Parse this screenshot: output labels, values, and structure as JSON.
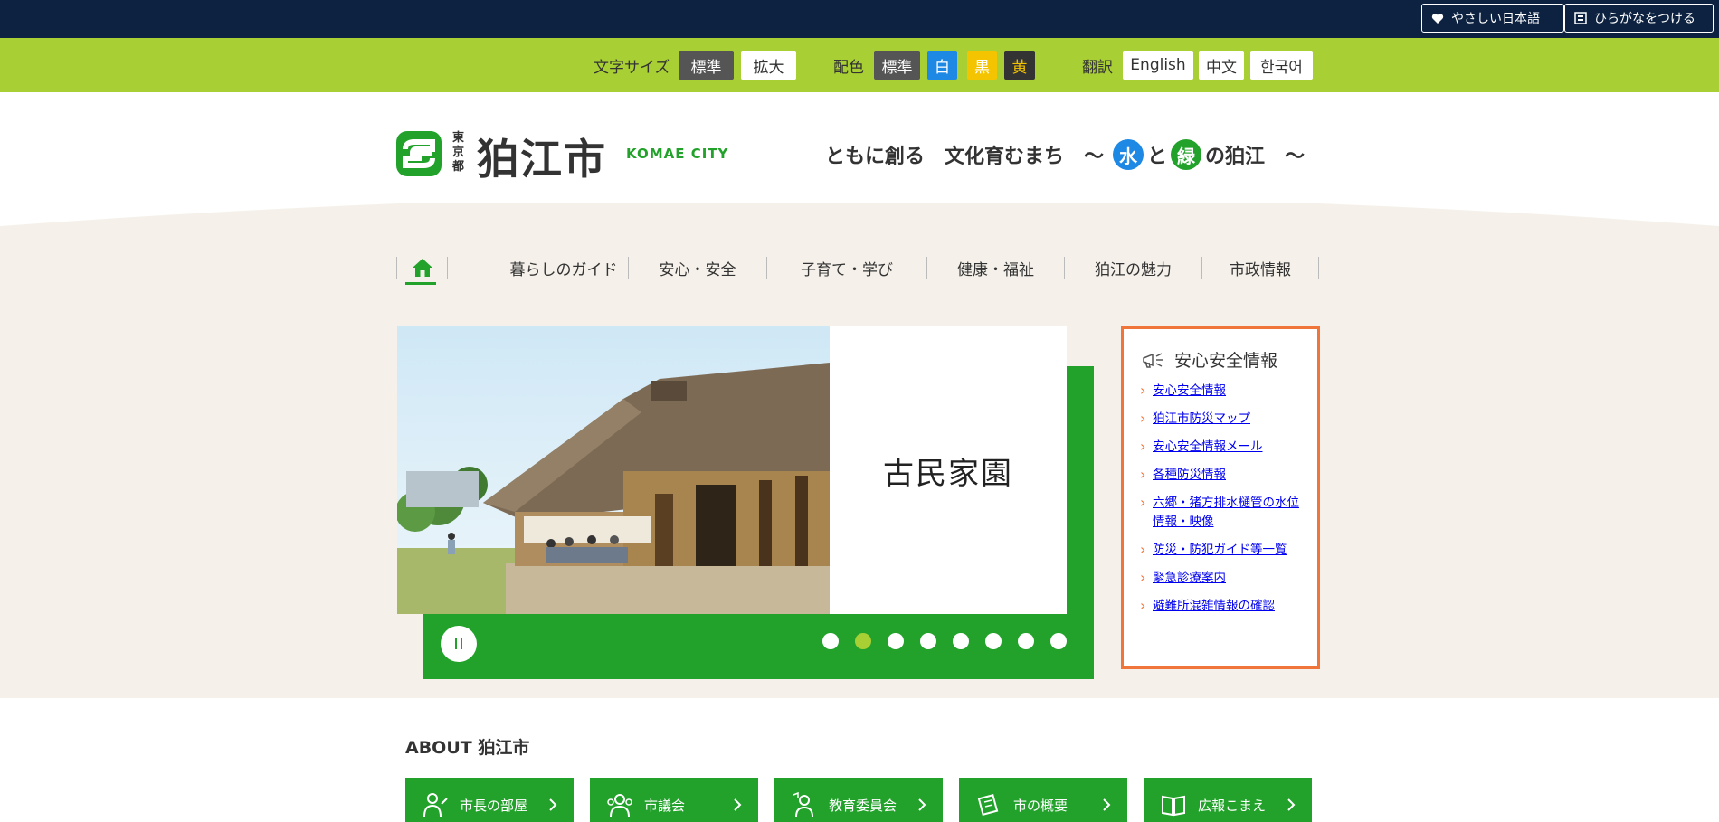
{
  "topbar": {
    "easy_japanese": "やさしい日本語",
    "furigana": "ひらがなをつける"
  },
  "accessibility": {
    "font_size_label": "文字サイズ",
    "font_size_standard": "標準",
    "font_size_large": "拡大",
    "color_label": "配色",
    "color_standard": "標準",
    "color_white": "白",
    "color_black": "黒",
    "color_yellow": "黄",
    "translate_label": "翻訳",
    "lang_english": "English",
    "lang_chinese": "中文",
    "lang_korean": "한국어"
  },
  "header": {
    "logo_prefix": "東京都",
    "logo_name": "狛江市",
    "logo_en": "KOMAE CITY",
    "tagline_part1": "ともに創る　文化育むまち　〜",
    "tagline_water": "水",
    "tagline_to": "と",
    "tagline_green": "緑",
    "tagline_part2": "の狛江　〜"
  },
  "nav": {
    "items": [
      {
        "label": "暮らしのガイド"
      },
      {
        "label": "安心・安全"
      },
      {
        "label": "子育て・学び"
      },
      {
        "label": "健康・福祉"
      },
      {
        "label": "狛江の魅力"
      },
      {
        "label": "市政情報"
      }
    ]
  },
  "slideshow": {
    "caption": "古民家園",
    "slide_count": 8,
    "active_slide": 2
  },
  "safety": {
    "title": "安心安全情報",
    "links": [
      "安心安全情報",
      "狛江市防災マップ",
      "安心安全情報メール",
      "各種防災情報",
      "六郷・猪方排水樋管の水位情報・映像",
      "防災・防犯ガイド等一覧",
      "緊急診療案内",
      "避難所混雑情報の確認"
    ]
  },
  "about": {
    "title": "ABOUT 狛江市",
    "cards": [
      {
        "label": "市長の部屋"
      },
      {
        "label": "市議会"
      },
      {
        "label": "教育委員会"
      },
      {
        "label": "市の概要"
      },
      {
        "label": "広報こまえ"
      }
    ]
  },
  "colors": {
    "navy": "#0c2240",
    "lime": "#a8cf33",
    "green": "#22a22b",
    "orange": "#f0753a",
    "beige": "#f5f1ea"
  }
}
